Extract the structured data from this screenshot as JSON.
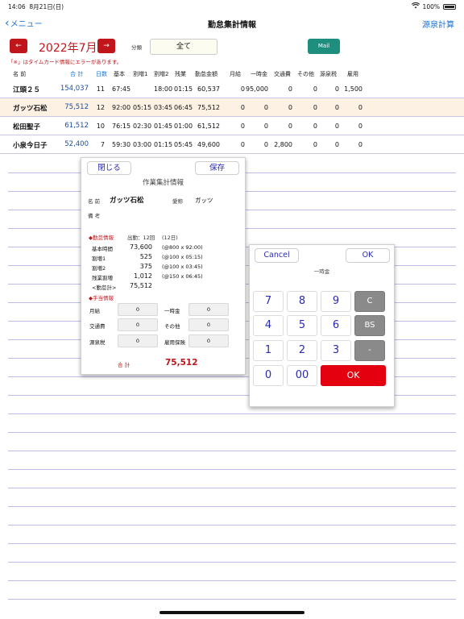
{
  "status": {
    "time": "14:06",
    "date": "8月21日(日)",
    "battery": "100%"
  },
  "nav": {
    "back_label": "メニュー",
    "title": "勤怠集計情報",
    "right_label": "源泉計算"
  },
  "period": {
    "prev_label": "←",
    "month": "2022年7月",
    "next_label": "→"
  },
  "category": {
    "label": "分類",
    "value": "全て"
  },
  "mail_label": "Mail",
  "error_note": "「※」はタイムカード情報にエラーがあります。",
  "colors": {
    "accent_red": "#c0151b",
    "link_blue": "#1a73d9",
    "mail_green": "#1e8e7f",
    "ok_red": "#e4000f"
  },
  "table": {
    "headers": [
      "名 前",
      "合 計",
      "日数",
      "基本",
      "割増1",
      "割増2",
      "残業",
      "勤怠金額",
      "月給",
      "一時金",
      "交通費",
      "その他",
      "源泉税",
      "雇用"
    ],
    "rows": [
      {
        "name": "江頭２５",
        "total": "154,037",
        "days": "11",
        "kihon": "67:45",
        "w1": "",
        "w2": "18:00",
        "zan": "01:15",
        "kingaku": "60,537",
        "gekkyu": "0",
        "ichiji": "95,000",
        "kotsu": "0",
        "sonota": "0",
        "gensen": "0",
        "koyo": "1,500"
      },
      {
        "name": "ガッツ石松",
        "total": "75,512",
        "days": "12",
        "kihon": "92:00",
        "w1": "05:15",
        "w2": "03:45",
        "zan": "06:45",
        "kingaku": "75,512",
        "gekkyu": "0",
        "ichiji": "0",
        "kotsu": "0",
        "sonota": "0",
        "gensen": "0",
        "koyo": "0"
      },
      {
        "name": "松田聖子",
        "total": "61,512",
        "days": "10",
        "kihon": "76:15",
        "w1": "02:30",
        "w2": "01:45",
        "zan": "01:00",
        "kingaku": "61,512",
        "gekkyu": "0",
        "ichiji": "0",
        "kotsu": "0",
        "sonota": "0",
        "gensen": "0",
        "koyo": "0"
      },
      {
        "name": "小泉今日子",
        "total": "52,400",
        "days": "7",
        "kihon": "59:30",
        "w1": "03:00",
        "w2": "01:15",
        "zan": "05:45",
        "kingaku": "49,600",
        "gekkyu": "0",
        "ichiji": "0",
        "kotsu": "2,800",
        "sonota": "0",
        "gensen": "0",
        "koyo": "0"
      }
    ]
  },
  "detail": {
    "close_label": "閉じる",
    "save_label": "保存",
    "title": "作業集計情報",
    "name_label": "名 前",
    "name_value": "ガッツ石松",
    "alias_label": "愛称",
    "alias_value": "ガッツ",
    "memo_label": "備 考",
    "work_header": "◆勤怠情報",
    "attendance": "出勤：12回",
    "attendance2": "(12日)",
    "work_lines": [
      {
        "label": "基本時間",
        "amount": "73,600",
        "calc": "(@800 x 92:00)"
      },
      {
        "label": "割増1",
        "amount": "525",
        "calc": "(@100 x 05:15)"
      },
      {
        "label": "割増2",
        "amount": "375",
        "calc": "(@100 x 03:45)"
      },
      {
        "label": "残業割増",
        "amount": "1,012",
        "calc": "(@150 x 06:45)"
      },
      {
        "label": "<勤怠計>",
        "amount": "75,512",
        "calc": ""
      }
    ],
    "allow_header": "◆手当情報",
    "allowances": [
      {
        "label": "月給",
        "value": "0"
      },
      {
        "label": "一時金",
        "value": "0"
      },
      {
        "label": "交通費",
        "value": "0"
      },
      {
        "label": "その他",
        "value": "0"
      },
      {
        "label": "源泉税",
        "value": "0"
      },
      {
        "label": "雇用保険",
        "value": "0"
      }
    ],
    "total_label": "合 計",
    "total_value": "75,512"
  },
  "keypad": {
    "cancel_label": "Cancel",
    "ok_label": "OK",
    "field_label": "一時金",
    "keys": [
      "7",
      "8",
      "9",
      "C",
      "4",
      "5",
      "6",
      "BS",
      "1",
      "2",
      "3",
      "-",
      "0",
      "00",
      "OK"
    ]
  }
}
